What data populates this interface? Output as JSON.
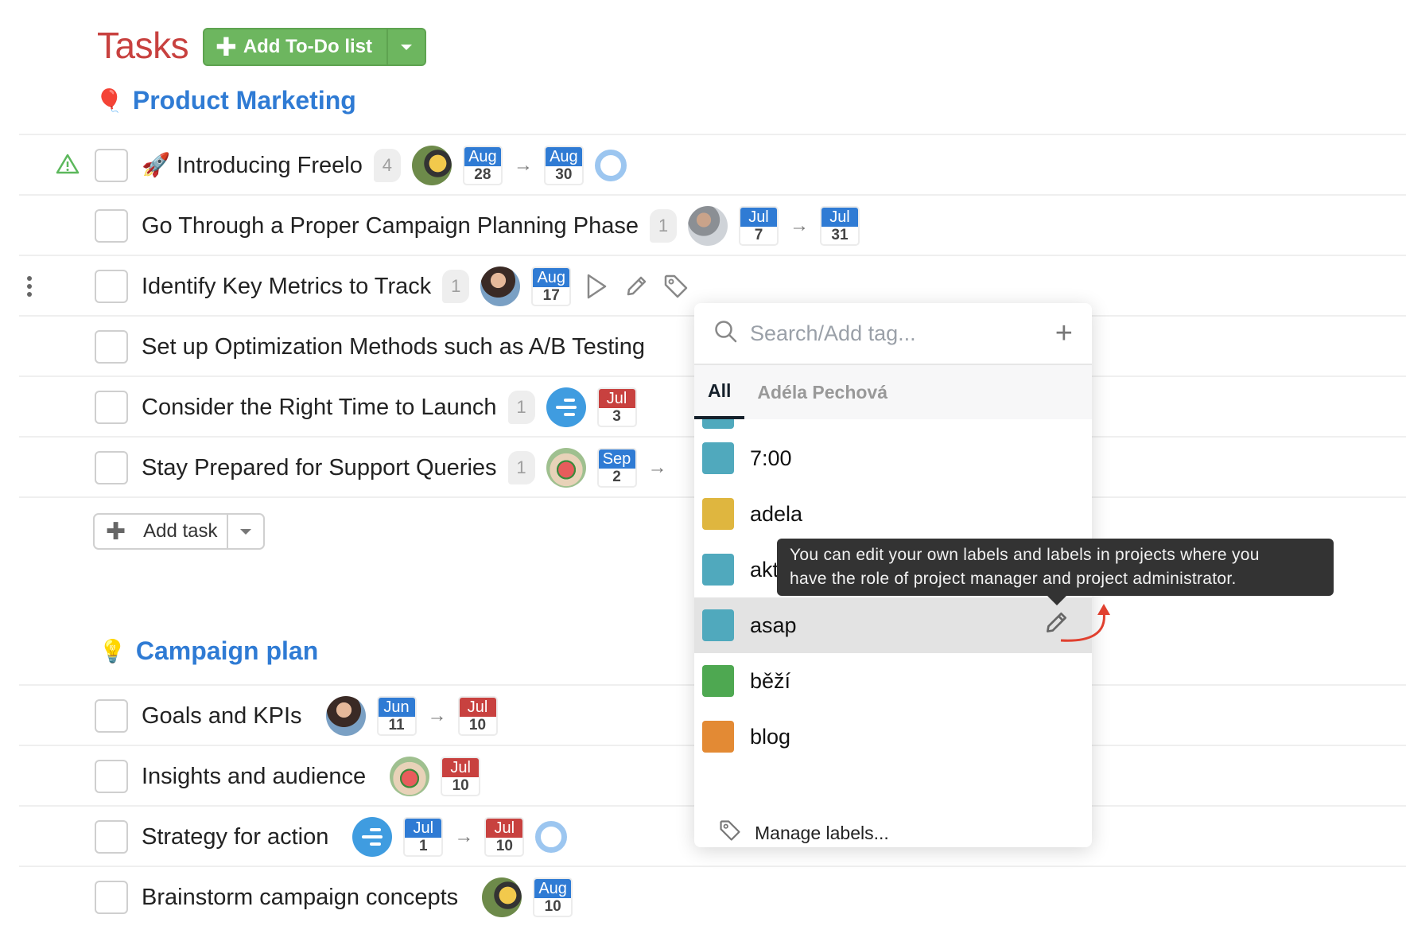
{
  "header": {
    "title": "Tasks",
    "add_todo_label": "Add To-Do list"
  },
  "lists": [
    {
      "title": "Product Marketing",
      "emoji": "🎈",
      "tasks": [
        {
          "title": "Introducing Freelo",
          "emoji": "🚀",
          "count": "4",
          "warning": true,
          "avatar": "av1",
          "start": {
            "month": "Aug",
            "day": "28",
            "color": "blue"
          },
          "end": {
            "month": "Aug",
            "day": "30",
            "color": "blue"
          },
          "progress_ring": true
        },
        {
          "title": "Go Through a Proper Campaign Planning Phase",
          "count": "1",
          "avatar": "av2",
          "start": {
            "month": "Jul",
            "day": "7",
            "color": "blue"
          },
          "end": {
            "month": "Jul",
            "day": "31",
            "color": "blue"
          }
        },
        {
          "title": "Identify Key Metrics to Track",
          "count": "1",
          "avatar": "av3",
          "end": {
            "month": "Aug",
            "day": "17",
            "color": "blue"
          },
          "hovered": true
        },
        {
          "title": "Set up Optimization Methods such as A/B Testing"
        },
        {
          "title": "Consider the Right Time to Launch",
          "count": "1",
          "assignee_icon": "unassigned-lines-icon",
          "end": {
            "month": "Jul",
            "day": "3",
            "color": "red"
          }
        },
        {
          "title": "Stay Prepared for Support Queries",
          "count": "1",
          "avatar": "av4",
          "start": {
            "month": "Sep",
            "day": "2",
            "color": "blue"
          }
        }
      ],
      "add_task_label": "Add task"
    },
    {
      "title": "Campaign plan",
      "emoji": "💡",
      "tasks": [
        {
          "title": "Goals and KPIs",
          "avatar": "av3",
          "start": {
            "month": "Jun",
            "day": "11",
            "color": "blue"
          },
          "end": {
            "month": "Jul",
            "day": "10",
            "color": "red"
          }
        },
        {
          "title": "Insights and audience",
          "avatar": "av4",
          "end": {
            "month": "Jul",
            "day": "10",
            "color": "red"
          }
        },
        {
          "title": "Strategy for action",
          "assignee_icon": "unassigned-lines-icon",
          "start": {
            "month": "Jul",
            "day": "1",
            "color": "blue"
          },
          "end": {
            "month": "Jul",
            "day": "10",
            "color": "red"
          },
          "progress_ring": true
        },
        {
          "title": "Brainstorm campaign concepts",
          "avatar": "av1",
          "end": {
            "month": "Aug",
            "day": "10",
            "color": "blue"
          }
        }
      ]
    }
  ],
  "tag_dropdown": {
    "search_placeholder": "Search/Add tag...",
    "tabs": [
      {
        "label": "All",
        "active": true
      },
      {
        "label": "Adéla Pechová",
        "active": false
      }
    ],
    "tags": [
      {
        "label": "7:00",
        "color": "#50a9bd"
      },
      {
        "label": "adela",
        "color": "#dfb63f"
      },
      {
        "label": "akt",
        "color": "#50a9bd"
      },
      {
        "label": "asap",
        "color": "#50a9bd",
        "hovered": true
      },
      {
        "label": "běží",
        "color": "#4ea851"
      },
      {
        "label": "blog",
        "color": "#e38a34"
      }
    ],
    "manage_label": "Manage labels..."
  },
  "tooltip": {
    "line1": "You can edit your own labels and labels in projects where you",
    "line2": "have the role of project manager and project administrator."
  },
  "colors": {
    "accent_blue": "#2f7bd4",
    "title_red": "#c8413f",
    "add_green": "#6db65f",
    "annotation_red": "#e0402f"
  }
}
